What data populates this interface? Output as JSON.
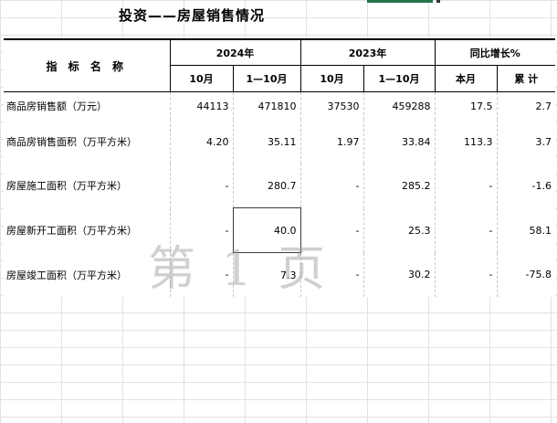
{
  "title": "投资——房屋销售情况",
  "header": {
    "metric": "指 标 名 称",
    "year_2024": "2024年",
    "year_2023": "2023年",
    "yoy": "同比增长%",
    "col_oct_2024": "10月",
    "col_ytd_2024": "1—10月",
    "col_oct_2023": "10月",
    "col_ytd_2023": "1—10月",
    "col_month": "本月",
    "col_cum": "累 计"
  },
  "rows": [
    {
      "label": "商品房销售额（万元）",
      "oct_2024": "44113",
      "ytd_2024": "471810",
      "oct_2023": "37530",
      "ytd_2023": "459288",
      "yoy_month": "17.5",
      "yoy_cum": "2.7"
    },
    {
      "label": "商品房销售面积（万平方米）",
      "oct_2024": "4.20",
      "ytd_2024": "35.11",
      "oct_2023": "1.97",
      "ytd_2023": "33.84",
      "yoy_month": "113.3",
      "yoy_cum": "3.7"
    },
    {
      "label": "房屋施工面积（万平方米）",
      "oct_2024": "-",
      "ytd_2024": "280.7",
      "oct_2023": "-",
      "ytd_2023": "285.2",
      "yoy_month": "-",
      "yoy_cum": "-1.6"
    },
    {
      "label": "房屋新开工面积（万平方米）",
      "oct_2024": "-",
      "ytd_2024": "40.0",
      "oct_2023": "-",
      "ytd_2023": "25.3",
      "yoy_month": "-",
      "yoy_cum": "58.1"
    },
    {
      "label": "房屋竣工面积（万平方米）",
      "oct_2024": "-",
      "ytd_2024": "7.3",
      "oct_2023": "-",
      "ytd_2023": "30.2",
      "yoy_month": "-",
      "yoy_cum": "-75.8"
    }
  ],
  "watermark": "第 1 页",
  "colors": {
    "selection_accent": "#217346",
    "grid": "#e2e2e2"
  }
}
